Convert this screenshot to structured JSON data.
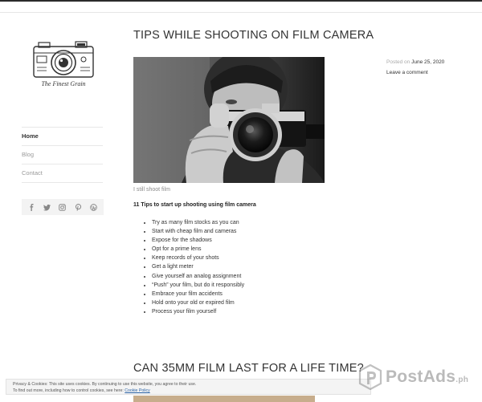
{
  "site": {
    "logo_text": "The Finest Grain"
  },
  "nav": {
    "items": [
      {
        "label": "Home",
        "active": true
      },
      {
        "label": "Blog",
        "active": false
      },
      {
        "label": "Contact",
        "active": false
      }
    ]
  },
  "social": {
    "icons": [
      "facebook-icon",
      "twitter-icon",
      "instagram-icon",
      "pinterest-icon",
      "wordpress-icon"
    ]
  },
  "post": {
    "title": "TIPS WHILE SHOOTING ON FILM CAMERA",
    "image_caption": "I still shoot film",
    "tips_heading": "11 Tips to start up shooting using film camera",
    "tips": [
      "Try as many film stocks as you can",
      "Start with cheap film and cameras",
      "Expose for the shadows",
      "Opt for a prime lens",
      "Keep records of your shots",
      "Get a light meter",
      "Give yourself an analog assignment",
      "“Push” your film, but do it responsibly",
      "Embrace your film accidents",
      "Hold onto your old or expired film",
      "Process your film yourself"
    ],
    "meta": {
      "posted_on_label": "Posted on",
      "date": "June 25, 2020",
      "comment_link": "Leave a comment"
    }
  },
  "next_post": {
    "title": "CAN 35MM FILM LAST FOR A LIFE TIME?"
  },
  "cookie_notice": {
    "line1": "Privacy & Cookies: This site uses cookies. By continuing to use this website, you agree to their use.",
    "line2_prefix": "To find out more, including how to control cookies, see here:",
    "link_text": "Cookie Policy"
  },
  "watermark": {
    "brand": "PostAds",
    "suffix": ".ph"
  }
}
